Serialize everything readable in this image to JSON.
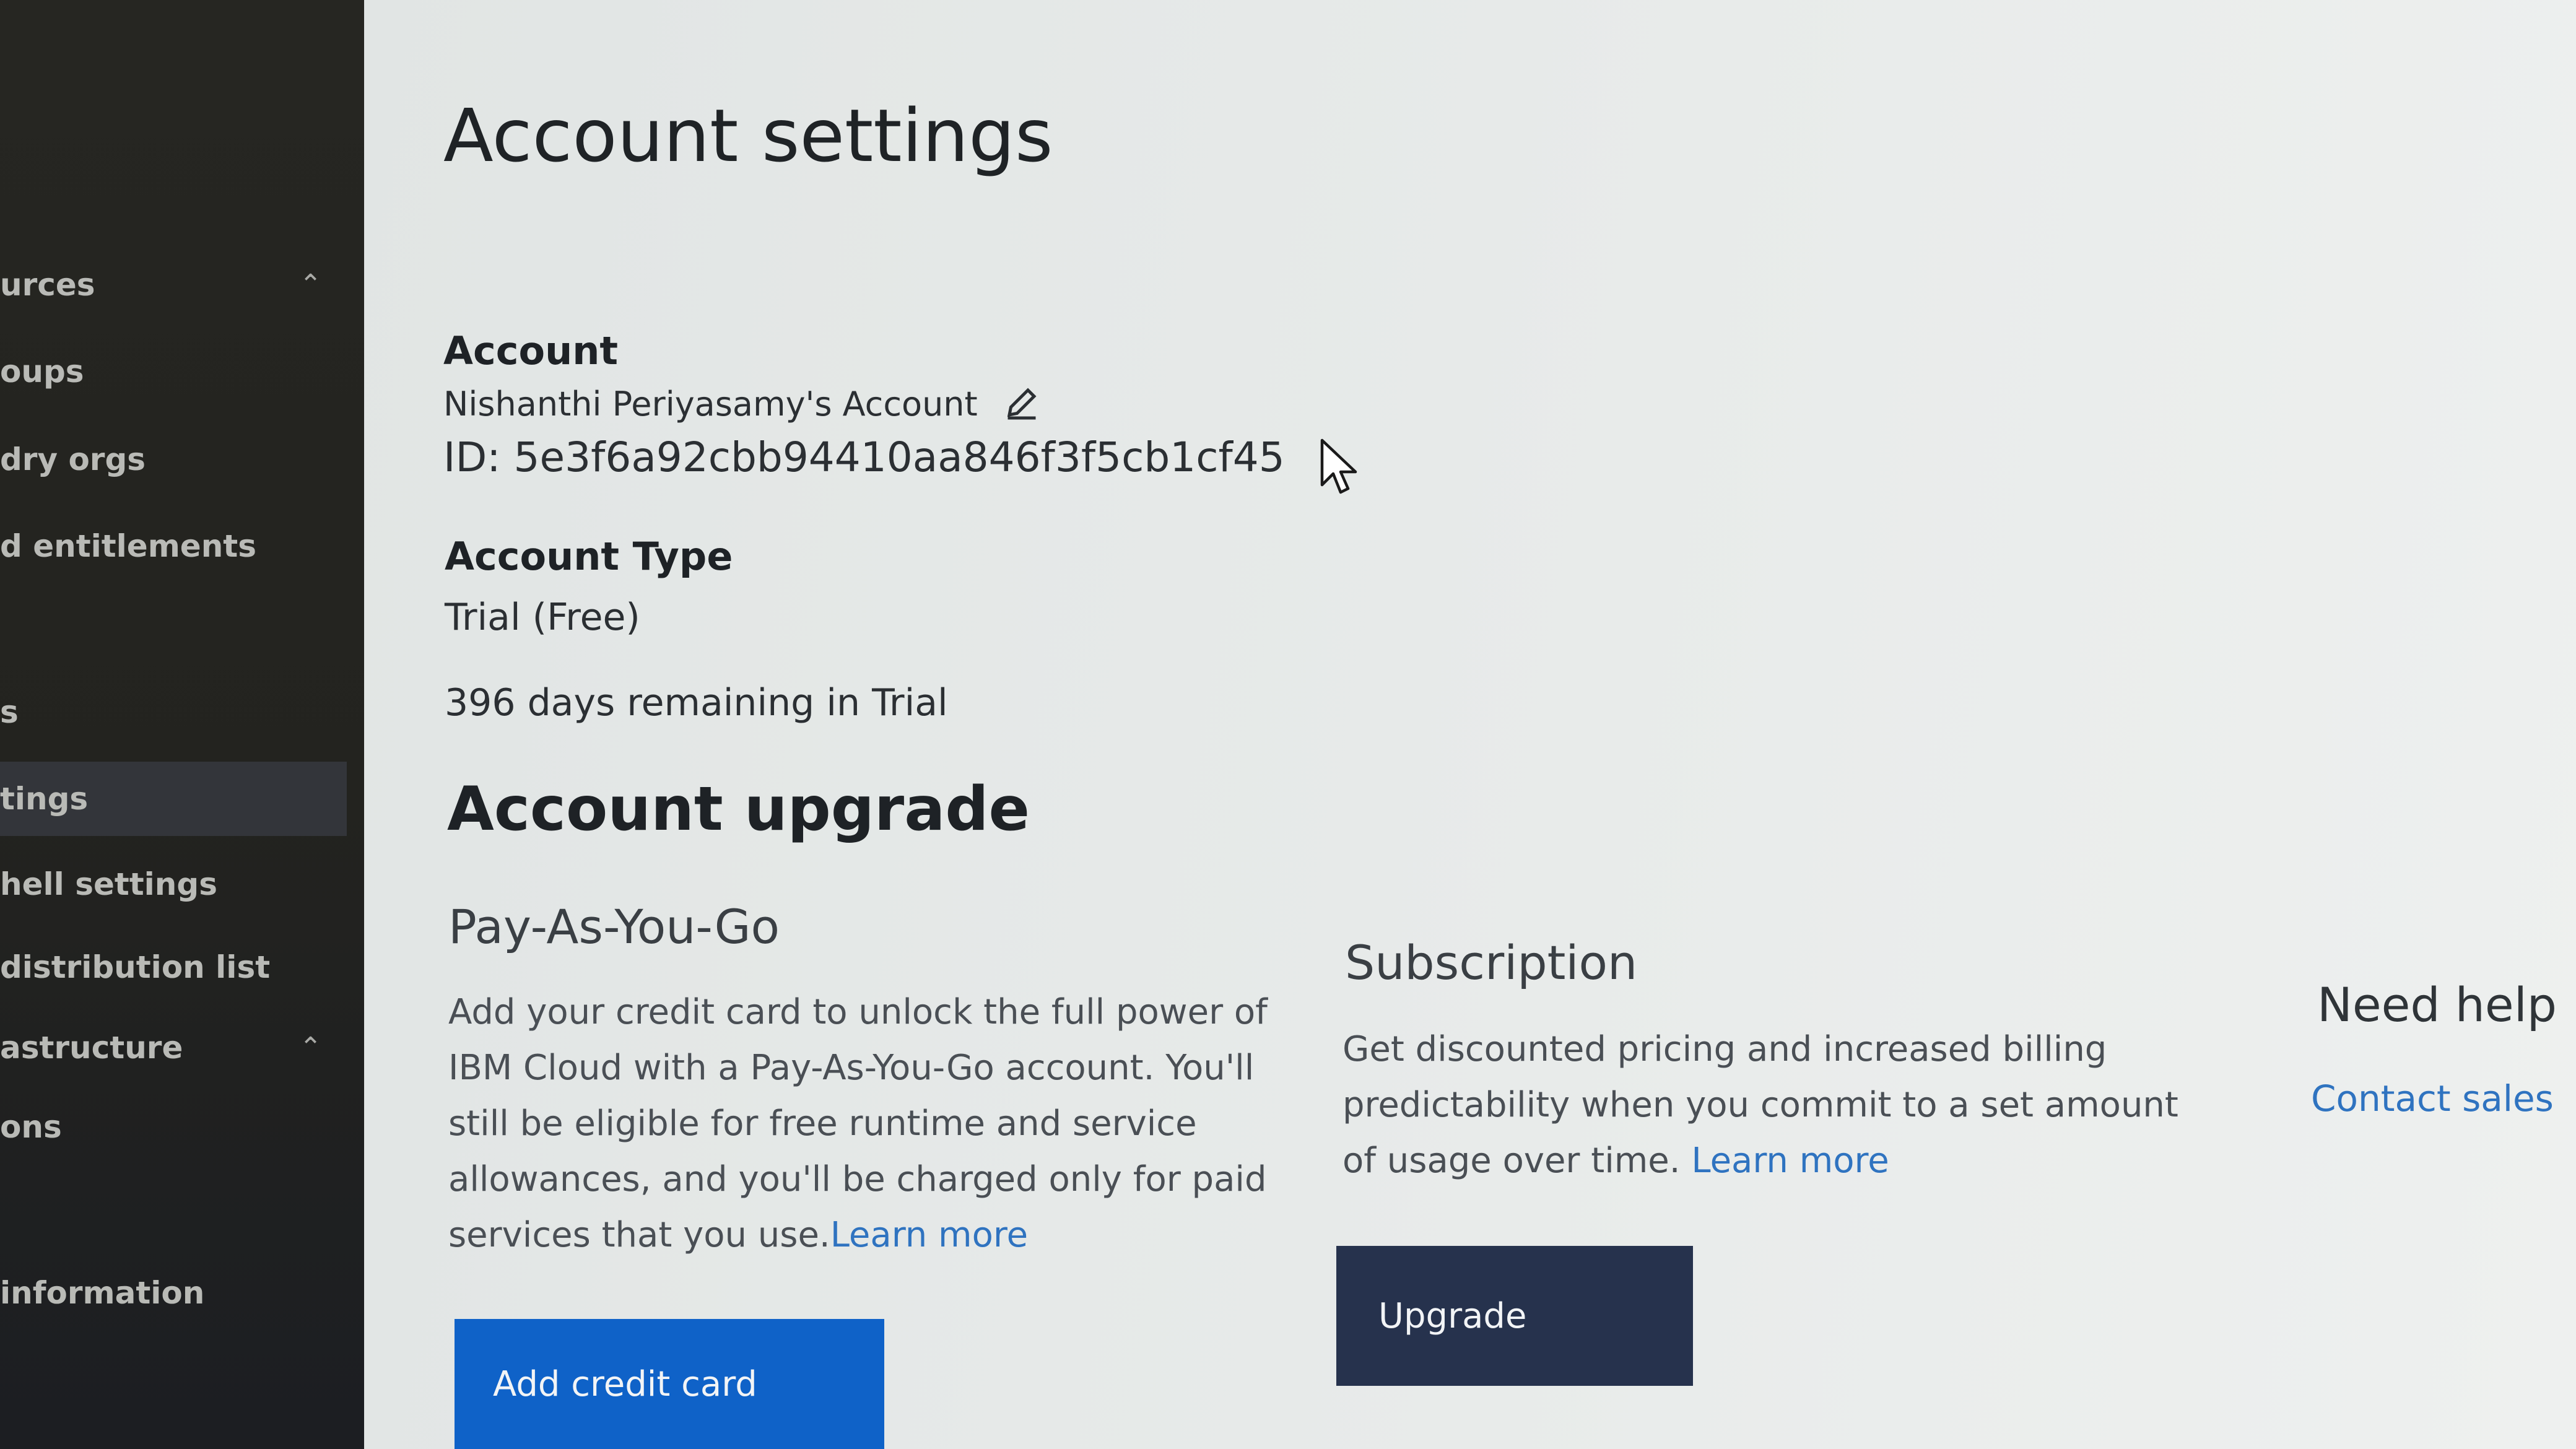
{
  "sidebar": {
    "items": [
      {
        "label": "urces",
        "chevron": "^"
      },
      {
        "label": "oups"
      },
      {
        "label": "dry orgs"
      },
      {
        "label": "d entitlements"
      },
      {
        "label": "s"
      },
      {
        "label": "tings"
      },
      {
        "label": "hell settings"
      },
      {
        "label": " distribution list"
      },
      {
        "label": "astructure",
        "chevron": "^"
      },
      {
        "label": "ons"
      },
      {
        "label": "information"
      }
    ]
  },
  "page": {
    "title": "Account settings"
  },
  "account": {
    "heading": "Account",
    "name": "Nishanthi Periyasamy's Account",
    "edit_icon": "pencil-icon",
    "id_text": "ID: 5e3f6a92cbb94410aa846f3f5cb1cf45"
  },
  "account_type": {
    "heading": "Account Type",
    "value": "Trial (Free)",
    "days_remaining": "396 days remaining in Trial"
  },
  "upgrade": {
    "heading": "Account upgrade",
    "payg": {
      "title": "Pay-As-You-Go",
      "description": "Add your credit card to unlock the full power of IBM Cloud with a Pay-As-You-Go account. You'll still be eligible for free runtime and service allowances, and you'll be charged only for paid services that you use.",
      "link": "Learn more",
      "button": "Add credit card"
    },
    "subscription": {
      "title": "Subscription",
      "description": "Get discounted pricing and increased billing predictability when you commit to a set amount of usage over time.",
      "link": "Learn more",
      "button": "Upgrade"
    },
    "help": {
      "title": "Need help",
      "link": "Contact sales"
    }
  },
  "colors": {
    "primary_button": "#0f62c8",
    "dark_button": "#26324d",
    "link": "#2f73c0",
    "sidebar_bg": "#262622"
  }
}
